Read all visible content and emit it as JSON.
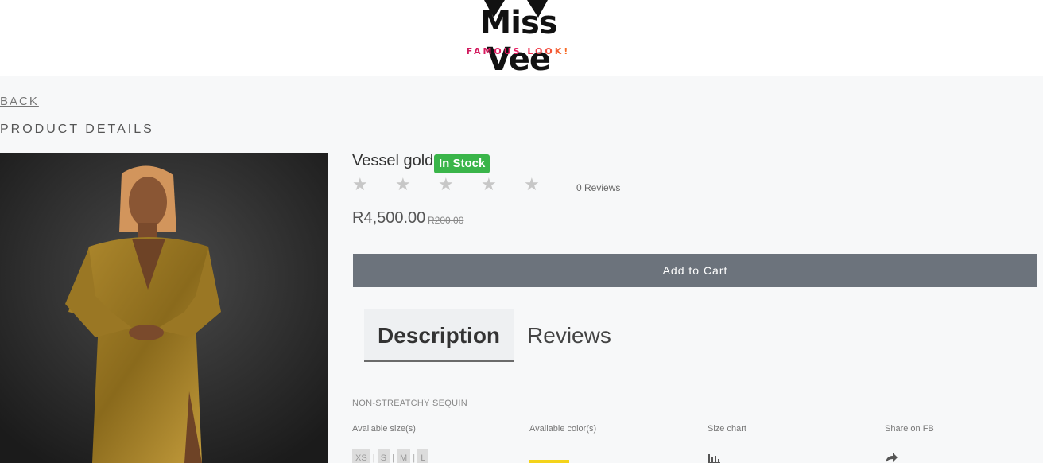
{
  "brand": {
    "name": "Miss Vee",
    "tagline": "FAMOUS LOOK!"
  },
  "nav": {
    "back_label": "BACK"
  },
  "page": {
    "section_title": "PRODUCT DETAILS"
  },
  "product": {
    "name": "Vessel gold",
    "stock_status": "In Stock",
    "rating": 0,
    "max_rating": 5,
    "review_count_label": "0 Reviews",
    "price": "R4,500.00",
    "old_price": "R200.00",
    "add_to_cart_label": "Add to Cart",
    "description": "NON-STREATCHY SEQUIN",
    "image_icon": "model-in-gold-sequin-dress-photo"
  },
  "tabs": [
    {
      "label": "Description",
      "active": true
    },
    {
      "label": "Reviews",
      "active": false
    }
  ],
  "attributes": {
    "sizes_label": "Available size(s)",
    "sizes": [
      "XS",
      "S",
      "M",
      "L"
    ],
    "colors_label": "Available color(s)",
    "colors": [
      "#f4d31a"
    ],
    "size_chart_label": "Size chart",
    "size_chart_icon": "chart-icon",
    "share_label": "Share on FB",
    "share_icon": "share-icon"
  },
  "colors": {
    "stock_badge": "#3ab54a",
    "cart_button": "#6c737c",
    "background": "#f7f8f9"
  }
}
